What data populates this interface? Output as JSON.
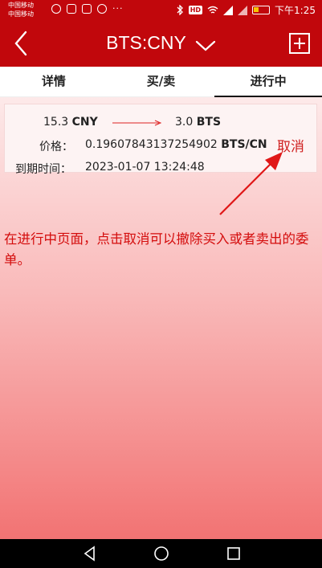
{
  "status_bar": {
    "carrier_1": "中国移动",
    "carrier_2": "中国移动",
    "more_glyph": "···",
    "hd_badge": "HD",
    "time": "下午1:25"
  },
  "header": {
    "title": "BTS:CNY",
    "back_icon": "chevron-left-icon",
    "dropdown_icon": "chevron-down-icon",
    "add_icon": "plus-square-icon"
  },
  "tabs": [
    {
      "label": "详情",
      "active": false
    },
    {
      "label": "买/卖",
      "active": false
    },
    {
      "label": "进行中",
      "active": true
    }
  ],
  "order": {
    "from_amount": "15.3",
    "from_currency": "CNY",
    "to_amount": "3.0",
    "to_currency": "BTS",
    "price_label": "价格：",
    "price_value": "0.19607843137254902",
    "price_unit": "BTS/CN",
    "expire_label": "到期时间：",
    "expire_value": "2023-01-07 13:24:48",
    "cancel_label": "取消"
  },
  "annotation": {
    "text": "在进行中页面，点击取消可以撤除买入或者卖出的委单。"
  },
  "colors": {
    "brand_red": "#c1070c",
    "annotation_red": "#d40d0d"
  }
}
